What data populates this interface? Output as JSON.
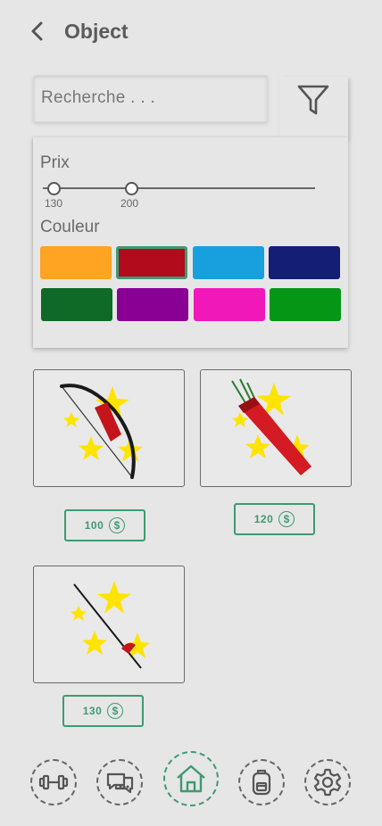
{
  "header": {
    "title": "Object",
    "back_icon": "chevron-left-icon"
  },
  "search": {
    "placeholder": "Recherche . . ."
  },
  "filter": {
    "icon": "filter-icon",
    "price_label": "Prix",
    "price_min": "130",
    "price_max": "200",
    "color_label": "Couleur",
    "colors": [
      "#ffa323",
      "#b10b1c",
      "#17a0dd",
      "#141e75",
      "#0e6a26",
      "#8a0095",
      "#f018b8",
      "#059615"
    ],
    "selected_color": "#b10b1c"
  },
  "items": [
    {
      "name": "bow",
      "price": "100"
    },
    {
      "name": "quiver",
      "price": "120"
    },
    {
      "name": "arrow",
      "price": "130"
    }
  ],
  "currency_symbol": "$",
  "nav": [
    {
      "icon": "dumbbell-icon"
    },
    {
      "icon": "chat-icon"
    },
    {
      "icon": "home-icon",
      "active": true
    },
    {
      "icon": "backpack-icon"
    },
    {
      "icon": "gear-icon"
    }
  ],
  "colors": {
    "accent": "#3e9a72",
    "sparkle": "#ffe400"
  }
}
